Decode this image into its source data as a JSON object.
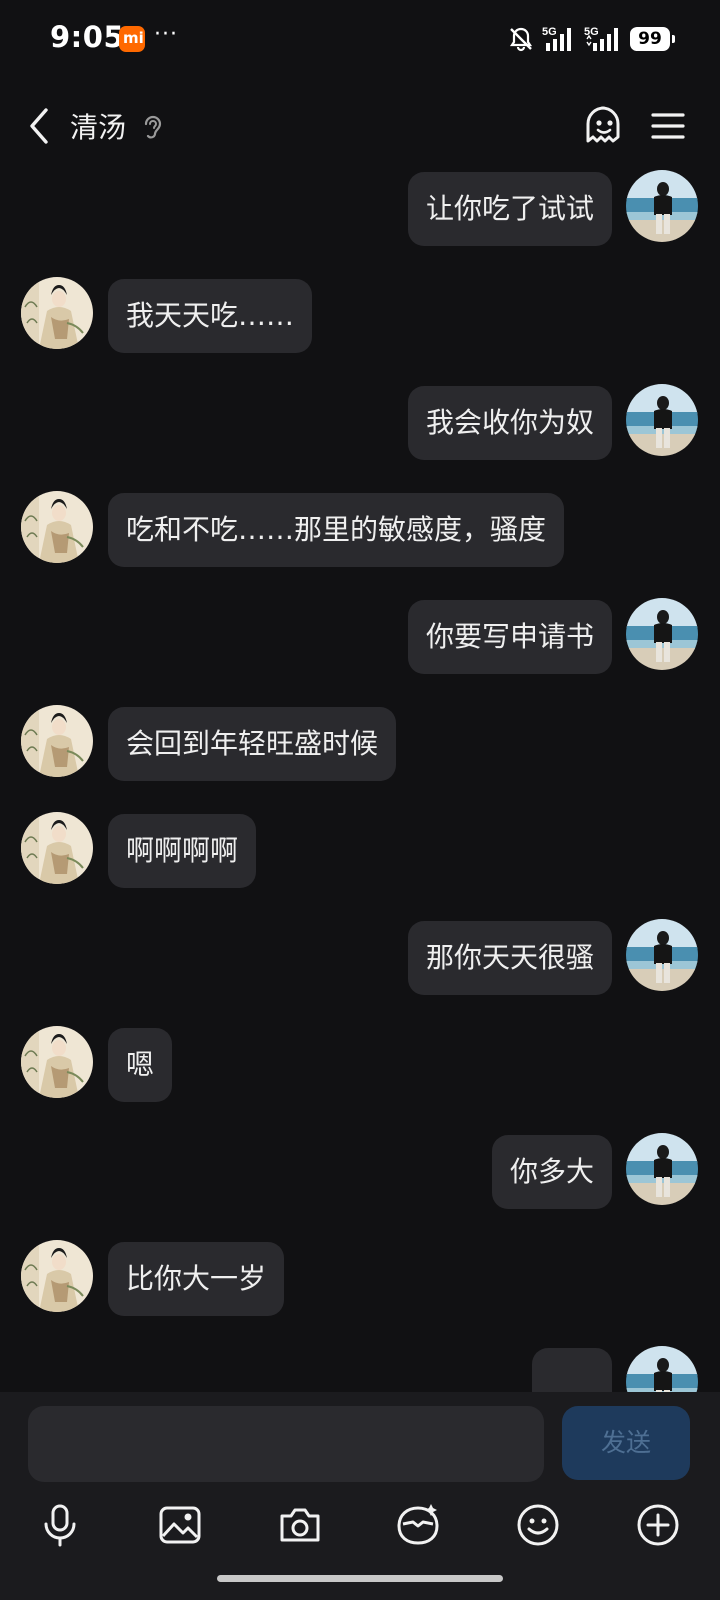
{
  "status_bar": {
    "time": "9:05",
    "mi_label": "mi",
    "more": "···",
    "signal1_label": "5G",
    "signal2_label": "5G",
    "battery": "99"
  },
  "header": {
    "contact_name": "清汤",
    "back_icon": "chevron-left-icon",
    "ear_icon": "ear-icon",
    "bot_icon": "bot-face-icon",
    "menu_icon": "hamburger-menu-icon"
  },
  "messages": [
    {
      "side": "right",
      "text": "让你吃了试试"
    },
    {
      "side": "left",
      "text": "我天天吃……"
    },
    {
      "side": "right",
      "text": "我会收你为奴"
    },
    {
      "side": "left",
      "text": "吃和不吃……那里的敏感度，骚度"
    },
    {
      "side": "right",
      "text": "你要写申请书"
    },
    {
      "side": "left",
      "text": "会回到年轻旺盛时候"
    },
    {
      "side": "left",
      "text": "啊啊啊啊"
    },
    {
      "side": "right",
      "text": "那你天天很骚"
    },
    {
      "side": "left",
      "text": "嗯"
    },
    {
      "side": "right",
      "text": "你多大"
    },
    {
      "side": "left",
      "text": "比你大一岁"
    },
    {
      "side": "right",
      "text": ""
    }
  ],
  "composer": {
    "input_value": "",
    "send_label": "发送"
  },
  "toolbar": [
    "microphone-icon",
    "image-icon",
    "camera-icon",
    "sticker-icon",
    "emoji-icon",
    "plus-icon"
  ],
  "colors": {
    "background": "#111113",
    "bubble": "#2a2a2e",
    "send_button": "#1e3a5c",
    "mi_orange": "#ff6900"
  }
}
